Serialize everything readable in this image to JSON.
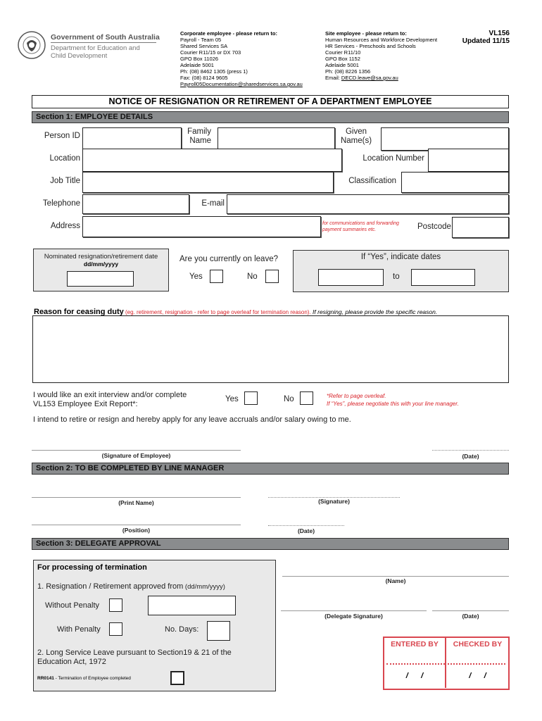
{
  "header": {
    "logo": {
      "icon": "sa-government-crest-icon",
      "line1": "Government of South Australia",
      "line2": "Department for Education and",
      "line3": "Child Development"
    },
    "corporate": {
      "title": "Corporate employee - please return to:",
      "lines": [
        "Payroll - Team 05",
        "Shared Services SA",
        "Courier R11/15 or DX 703",
        "GPO Box 11026",
        "Adelaide 5001",
        "Ph: (08) 8462 1305 (press 1)",
        "Fax: (08) 8124 9605"
      ],
      "email": "Payroll05Documentation@sharedservices.sa.gov.au"
    },
    "site": {
      "title": "Site employee - please return to:",
      "lines": [
        "Human Resources and Workforce Development",
        "HR Services - Preschools and Schools",
        "Courier R11/10",
        "GPO Box 1152",
        "Adelaide 5001",
        "Ph: (08) 8226 1356"
      ],
      "email_label": "Email: ",
      "email": "DECD.leave@sa.gov.au"
    },
    "form_code": "VL156",
    "updated": "Updated 11/15"
  },
  "title": "NOTICE OF RESIGNATION OR RETIREMENT OF A DEPARTMENT EMPLOYEE",
  "section1": {
    "heading": "Section 1: EMPLOYEE DETAILS",
    "person_id": "Person ID",
    "family_name_1": "Family",
    "family_name_2": "Name",
    "given_names_1": "Given",
    "given_names_2": "Name(s)",
    "location": "Location",
    "location_number": "Location Number",
    "job_title": "Job Title",
    "classification": "Classification",
    "telephone": "Telephone",
    "email": "E-mail",
    "address": "Address",
    "address_note_1": "for communications and forwarding",
    "address_note_2": "payment summaries etc.",
    "postcode": "Postcode",
    "nominated_date_label": "Nominated resignation/retirement date",
    "nominated_date_format": "dd/mm/yyyy",
    "on_leave_question": "Are you currently on leave?",
    "yes": "Yes",
    "no": "No",
    "if_yes_dates": "If “Yes”, indicate dates",
    "to": "to",
    "reason_label": "Reason for ceasing duty",
    "reason_hint": " (eg. retirement, resignation - refer to page overleaf for termination reason).",
    "reason_italic": " If resigning, please provide the specific reason.",
    "exit_interview_1": "I would like an exit interview and/or complete",
    "exit_interview_2": "VL153 Employee Exit Report*:",
    "exit_note_1": "*Refer to page overleaf.",
    "exit_note_2": "If “Yes”, please negotiate this with your line manager.",
    "declaration": "I intend to retire or resign and hereby apply for any leave accruals and/or salary owing to me.",
    "sig_employee": "(Signature of Employee)",
    "date": "(Date)"
  },
  "section2": {
    "heading": "Section 2: TO BE COMPLETED BY LINE MANAGER",
    "print_name": "(Print Name)",
    "signature": "(Signature)",
    "position": "(Position)",
    "date": "(Date)"
  },
  "section3": {
    "heading": "Section 3: DELEGATE APPROVAL",
    "processing_title": "For processing of termination",
    "item1": "1. Resignation / Retirement approved from",
    "item1_fmt": " (dd/mm/yyyy)",
    "without_penalty": "Without Penalty",
    "with_penalty": "With Penalty",
    "no_days": "No. Days:",
    "item2_1": "2. Long Service Leave pursuant to Section19 & 21 of the",
    "item2_2": "Education Act, 1972",
    "rr_code": "RR0141",
    "rr_text": " - Termination of Employee completed",
    "name": "(Name)",
    "delegate_signature": "(Delegate Signature)",
    "date": "(Date)",
    "entered_by": "ENTERED BY",
    "checked_by": "CHECKED BY",
    "date_slashes": "/      /"
  },
  "colors": {
    "section_bar": "#8a8c8e",
    "grey_box": "#e9e9e9",
    "accent_red": "#d8232a",
    "stamp_red": "#d9464f"
  }
}
